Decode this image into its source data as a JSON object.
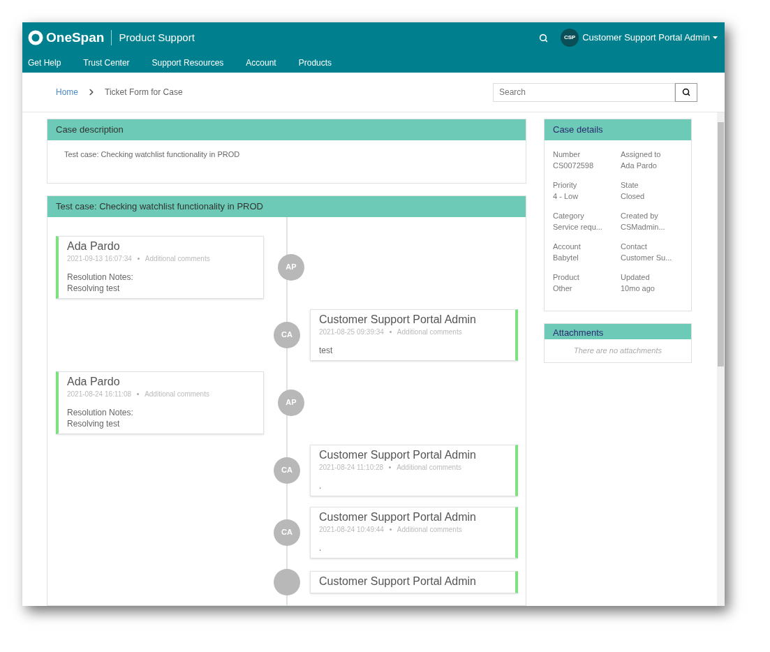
{
  "header": {
    "logo": "OneSpan",
    "product": "Product Support",
    "user_initials": "CSP",
    "user_name": "Customer Support Portal Admin"
  },
  "nav": [
    "Get Help",
    "Trust Center",
    "Support Resources",
    "Account",
    "Products"
  ],
  "breadcrumb": [
    "Home",
    "Ticket Form for Case"
  ],
  "search": {
    "placeholder": "Search"
  },
  "description": {
    "title": "Case description",
    "text": "Test case: Checking watchlist functionality in PROD"
  },
  "activity": {
    "title": "Test case: Checking watchlist functionality in PROD",
    "entries": [
      {
        "kind": "left",
        "initials": "AP",
        "name": "Ada Pardo",
        "time": "2021-09-13 16:07:34",
        "type": "Additional comments",
        "lines": [
          "Resolution Notes:",
          "Resolving test"
        ]
      },
      {
        "kind": "right",
        "initials": "CA",
        "name": "Customer Support Portal Admin",
        "time": "2021-08-25 09:39:34",
        "type": "Additional comments",
        "lines": [
          "test"
        ]
      },
      {
        "kind": "left",
        "initials": "AP",
        "name": "Ada Pardo",
        "time": "2021-08-24 16:11:08",
        "type": "Additional comments",
        "lines": [
          "Resolution Notes:",
          "Resolving test"
        ]
      },
      {
        "kind": "right",
        "initials": "CA",
        "name": "Customer Support Portal Admin",
        "time": "2021-08-24 11:10:28",
        "type": "Additional comments",
        "lines": [
          "."
        ]
      },
      {
        "kind": "right",
        "initials": "CA",
        "name": "Customer Support Portal Admin",
        "time": "2021-08-24 10:49:44",
        "type": "Additional comments",
        "lines": [
          "."
        ]
      },
      {
        "kind": "right",
        "name": "Customer Support Portal Admin"
      }
    ]
  },
  "details": {
    "title": "Case details",
    "fields": [
      {
        "label": "Number",
        "value": "CS0072598"
      },
      {
        "label": "Assigned to",
        "value": "Ada Pardo"
      },
      {
        "label": "Priority",
        "value": "4 - Low"
      },
      {
        "label": "State",
        "value": "Closed"
      },
      {
        "label": "Category",
        "value": "Service requ..."
      },
      {
        "label": "Created by",
        "value": "CSMadmin..."
      },
      {
        "label": "Account",
        "value": "Babytel"
      },
      {
        "label": "Contact",
        "value": "Customer Su..."
      },
      {
        "label": "Product",
        "value": "Other"
      },
      {
        "label": "Updated",
        "value": "10mo ago"
      }
    ]
  },
  "attachments": {
    "title": "Attachments",
    "empty": "There are no attachments"
  }
}
